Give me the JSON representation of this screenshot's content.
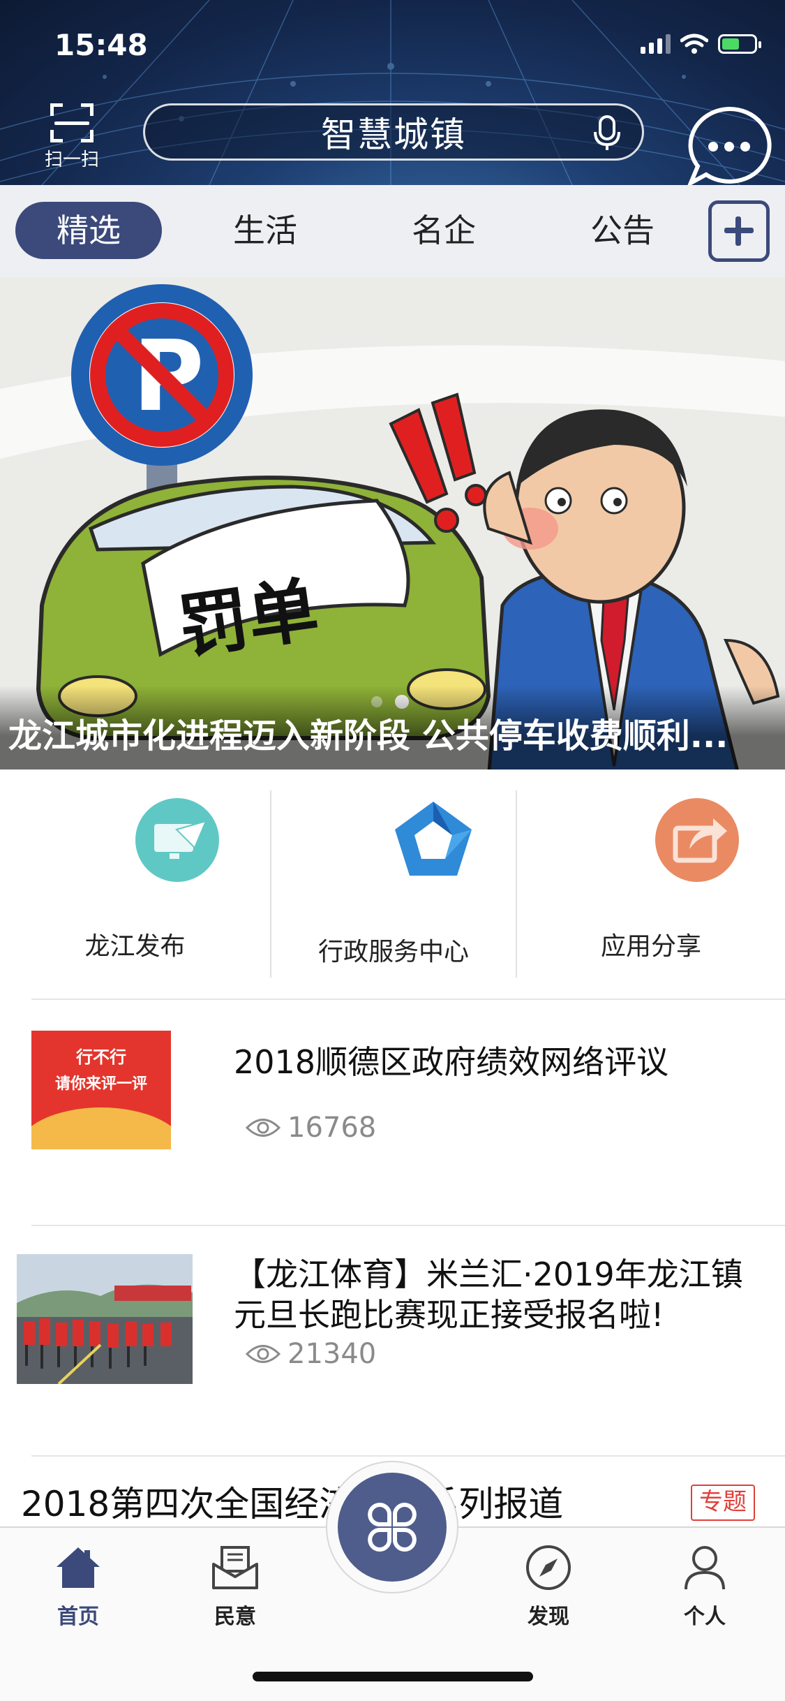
{
  "status_bar": {
    "time": "15:48"
  },
  "header": {
    "scan_label": "扫一扫",
    "search_text": "智慧城镇"
  },
  "tabs": [
    {
      "label": "精选",
      "active": true
    },
    {
      "label": "生活",
      "active": false
    },
    {
      "label": "名企",
      "active": false
    },
    {
      "label": "公告",
      "active": false
    }
  ],
  "banner": {
    "illustration_text": "罚单",
    "caption": "龙江城市化进程迈入新阶段 公共停车收费顺利...",
    "dots_total": 2,
    "dots_active": 2
  },
  "quick_actions": [
    {
      "label": "龙江发布",
      "icon": "computer-mail-icon"
    },
    {
      "label": "行政服务中心",
      "icon": "pentagon-logo-icon"
    },
    {
      "label": "应用分享",
      "icon": "share-icon"
    }
  ],
  "news": [
    {
      "title": "2018顺德区政府绩效网络评议",
      "views": "16768",
      "thumb_text_1": "行不行",
      "thumb_text_2": "请你来评一评"
    },
    {
      "title": "【龙江体育】米兰汇·2019年龙江镇元旦长跑比赛现正接受报名啦!",
      "views": "21340"
    }
  ],
  "topic": {
    "title": "2018第四次全国经济普查系列报道",
    "tag": "专题"
  },
  "tabbar": [
    {
      "label": "首页",
      "icon": "home-icon",
      "active": true
    },
    {
      "label": "民意",
      "icon": "mail-icon",
      "active": false
    },
    {
      "label": "发现",
      "icon": "compass-icon",
      "active": false
    },
    {
      "label": "个人",
      "icon": "person-icon",
      "active": false
    }
  ],
  "colors": {
    "primary": "#3b4a7a",
    "tag_red": "#e0403a",
    "header_dark": "#13264a"
  }
}
